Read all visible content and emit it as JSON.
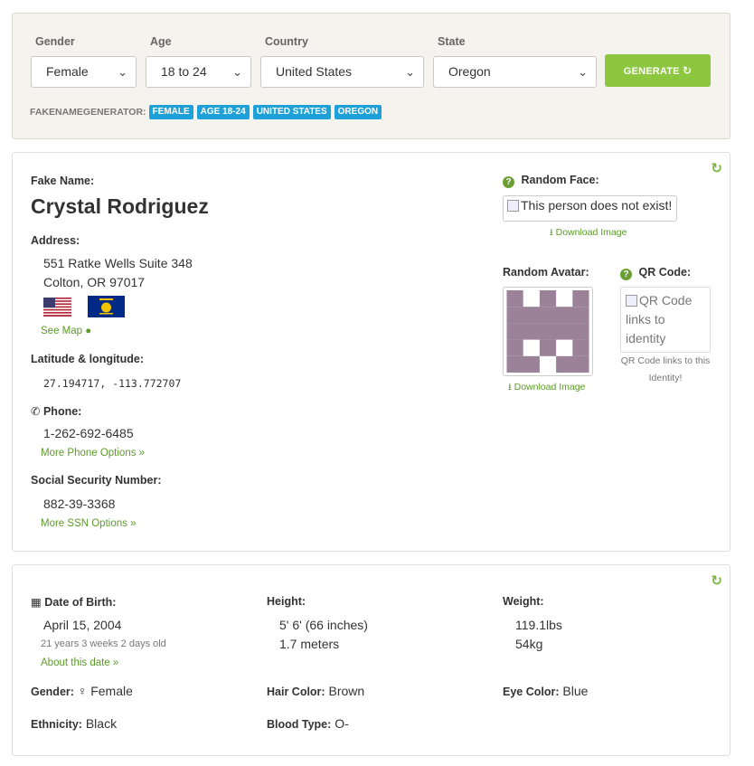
{
  "filters": {
    "gender": {
      "label": "Gender",
      "value": "Female"
    },
    "age": {
      "label": "Age",
      "value": "18 to 24"
    },
    "country": {
      "label": "Country",
      "value": "United States"
    },
    "state": {
      "label": "State",
      "value": "Oregon"
    },
    "generate_label": "GENERATE",
    "tags_label": "FAKENAMEGENERATOR:",
    "tags": [
      "FEMALE",
      "AGE 18-24",
      "UNITED STATES",
      "OREGON"
    ]
  },
  "identity": {
    "fake_name_label": "Fake Name:",
    "name": "Crystal Rodriguez",
    "address_label": "Address:",
    "address_line1": "551 Ratke Wells Suite 348",
    "address_line2": "Colton, OR 97017",
    "see_map": "See Map",
    "latlng_label": "Latitude & longitude:",
    "latlng": "27.194717, -113.772707",
    "phone_label": "Phone:",
    "phone": "1-262-692-6485",
    "more_phone": "More Phone Options »",
    "ssn_label": "Social Security Number:",
    "ssn": "882-39-3368",
    "more_ssn": "More SSN Options »",
    "random_face_label": "Random Face:",
    "face_alt": "This person does not exist!",
    "download_image": "Download Image",
    "random_avatar_label": "Random Avatar:",
    "qr_label": "QR Code:",
    "qr_alt": "QR Code links to identity",
    "qr_caption": "QR Code links to this Identity!",
    "avatar_color": "#9b8299"
  },
  "details": {
    "dob_label": "Date of Birth:",
    "dob": "April 15, 2004",
    "age_text": "21 years 3 weeks 2 days old",
    "about_date": "About this date »",
    "height_label": "Height:",
    "height_imperial": "5' 6' (66 inches)",
    "height_metric": "1.7 meters",
    "weight_label": "Weight:",
    "weight_lbs": "119.1lbs",
    "weight_kg": "54kg",
    "gender_label": "Gender:",
    "gender": "Female",
    "hair_label": "Hair Color:",
    "hair": "Brown",
    "eye_label": "Eye Color:",
    "eye": "Blue",
    "ethnicity_label": "Ethnicity:",
    "ethnicity": "Black",
    "blood_label": "Blood Type:",
    "blood": "O-"
  },
  "colors": {
    "accent_green": "#8dc63f",
    "tag_blue": "#1da1d8",
    "link_green": "#5d9a2a"
  }
}
